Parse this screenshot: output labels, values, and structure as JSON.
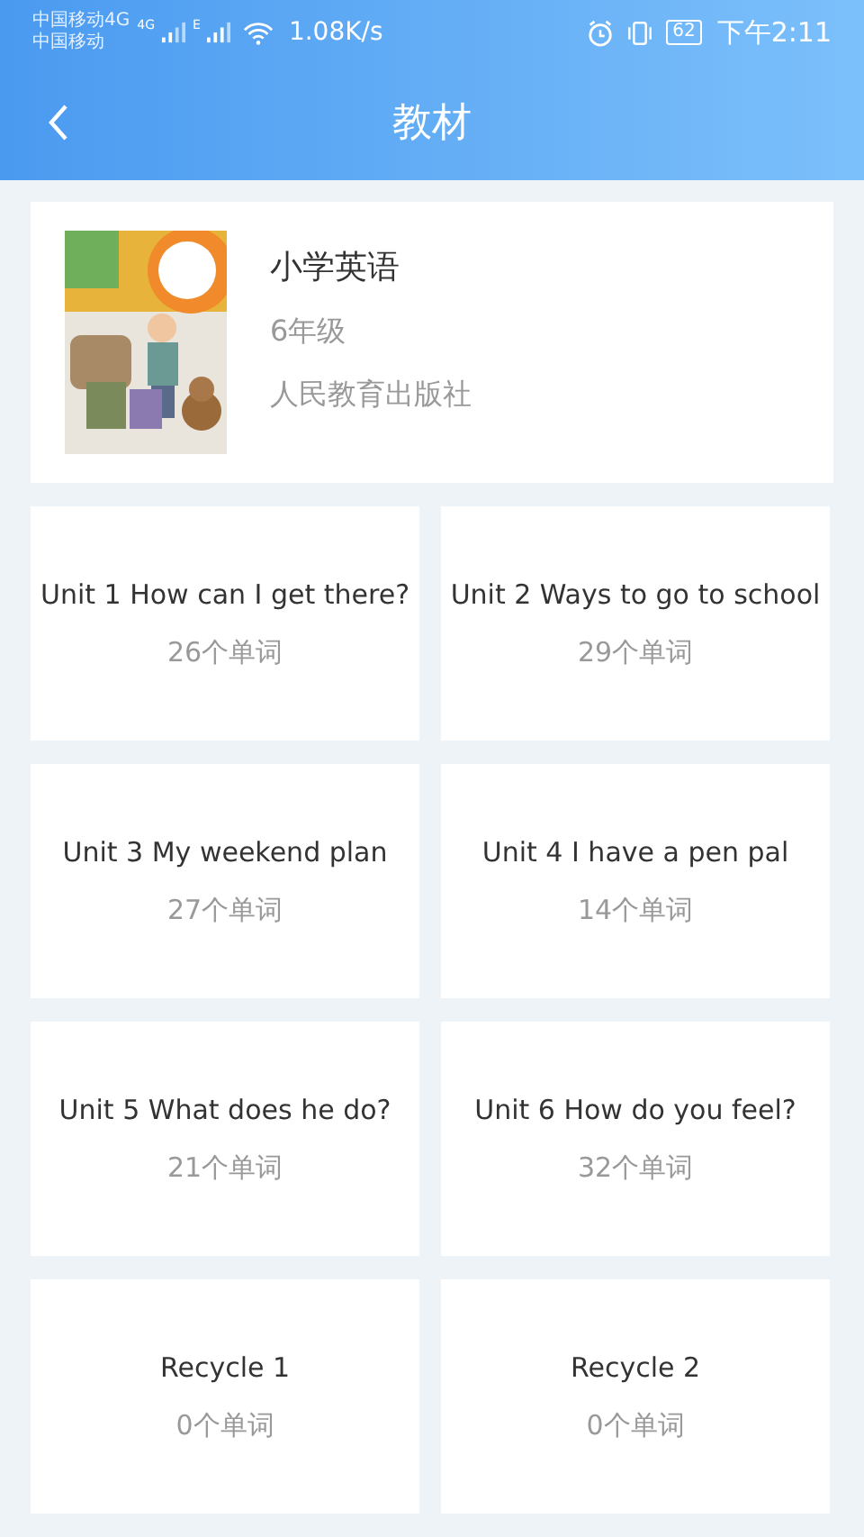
{
  "status_bar": {
    "carrier_1": "中国移动4G",
    "carrier_2": "中国移动",
    "signal_1_label": "4G",
    "signal_2_label": "E",
    "speed": "1.08K/s",
    "battery": "62",
    "time": "下午2:11"
  },
  "header": {
    "title": "教材"
  },
  "book": {
    "title": "小学英语",
    "grade": "6年级",
    "publisher": "人民教育出版社"
  },
  "units": [
    {
      "title": "Unit 1 How can I get there?",
      "count": "26个单词"
    },
    {
      "title": "Unit 2 Ways to go to school",
      "count": "29个单词"
    },
    {
      "title": "Unit 3 My weekend plan",
      "count": "27个单词"
    },
    {
      "title": "Unit 4 I have a pen pal",
      "count": "14个单词"
    },
    {
      "title": "Unit 5 What does he do?",
      "count": "21个单词"
    },
    {
      "title": "Unit 6 How do you feel?",
      "count": "32个单词"
    },
    {
      "title": "Recycle 1",
      "count": "0个单词"
    },
    {
      "title": "Recycle 2",
      "count": "0个单词"
    }
  ]
}
